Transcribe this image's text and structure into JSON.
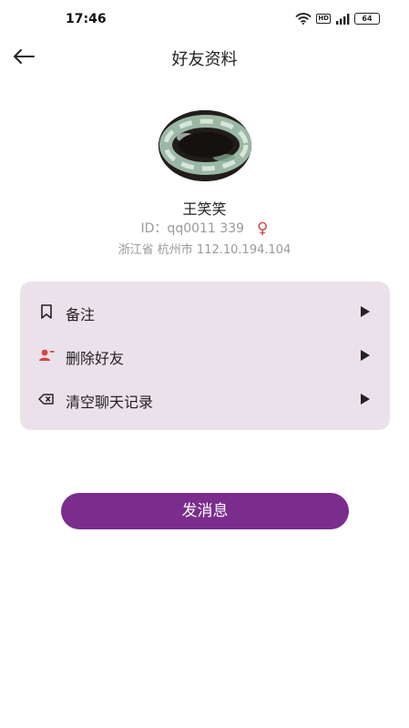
{
  "status": {
    "time": "17:46",
    "network_badge": "HD",
    "battery_label": "64"
  },
  "header": {
    "title": "好友资料"
  },
  "profile": {
    "nickname": "王笑笑",
    "id_label": "ID：",
    "id_value": "qq0011 339",
    "gender_symbol": "♀",
    "location": "浙江省 杭州市 112.10.194.104"
  },
  "menu": {
    "items": [
      {
        "label": "备注",
        "icon": "bookmark-icon"
      },
      {
        "label": "删除好友",
        "icon": "remove-user-icon"
      },
      {
        "label": "清空聊天记录",
        "icon": "clear-icon"
      }
    ]
  },
  "actions": {
    "send_label": "发消息"
  },
  "colors": {
    "accent": "#7b2d8e",
    "card_bg": "#ebe1ea",
    "danger": "#d64545"
  }
}
